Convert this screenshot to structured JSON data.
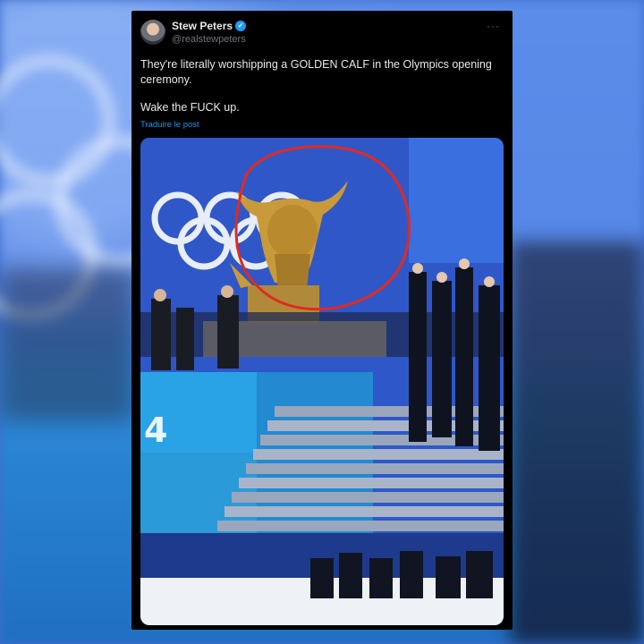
{
  "tweet": {
    "author_name": "Stew Peters",
    "author_handle": "@realstewpeters",
    "more_label": "···",
    "text_line1": "They're literally worshipping a GOLDEN CALF in the Olympics opening ceremony.",
    "text_line2": "Wake the FUCK up.",
    "translate_label": "Traduire le post"
  },
  "icons": {
    "verified": "verified-badge-icon",
    "more": "more-options-icon"
  },
  "media": {
    "stage_panel_text": "4"
  },
  "colors": {
    "verified_blue": "#1d9bf0",
    "annotation_red": "#e02a20",
    "statue_gold": "#c99a3a"
  }
}
